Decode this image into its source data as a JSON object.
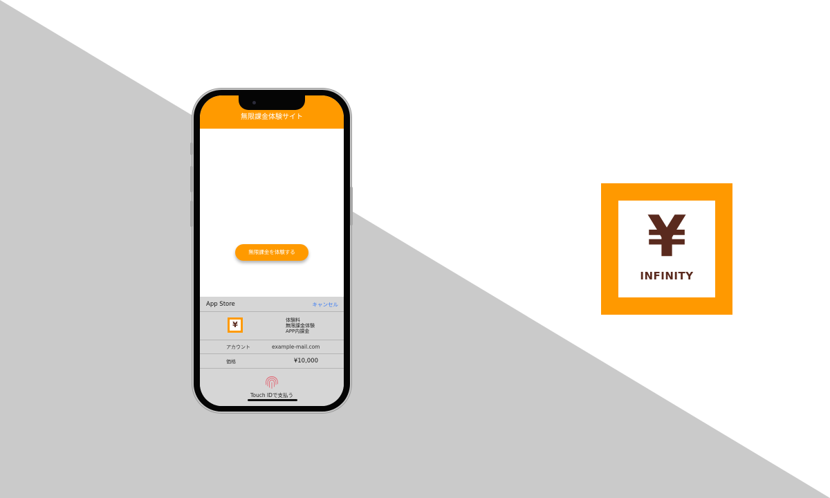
{
  "colors": {
    "brand_orange": "#ff9a00",
    "logo_brown": "#5a2a1e",
    "background_gray": "#cacaca",
    "background_white": "#ffffff",
    "link_blue": "#3478f6"
  },
  "app": {
    "header_title": "無限課金体験サイト",
    "cta_label": "無限課金を体験する"
  },
  "payment_sheet": {
    "store_name": "App Store",
    "cancel_label": "キャンセル",
    "app_icon_symbol": "¥",
    "item_lines": [
      "体験料",
      "無限課金体験",
      "APP内課金"
    ],
    "account_label": "アカウント",
    "account_value": "example-mail.com",
    "price_label": "価格",
    "price_value": "¥10,000",
    "touchid_label": "Touch IDで支払う",
    "touchid_icon": "fingerprint-icon"
  },
  "logo": {
    "symbol": "¥",
    "wordmark": "INFINITY"
  }
}
